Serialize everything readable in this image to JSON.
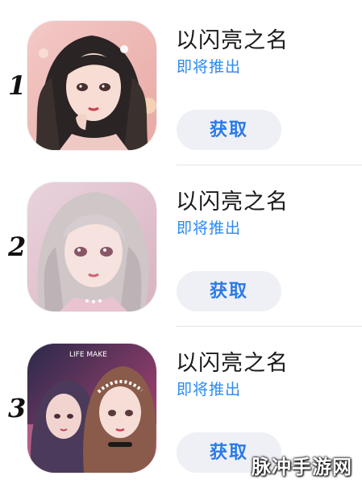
{
  "apps": [
    {
      "rank": "1",
      "title": "以闪亮之名",
      "subtitle": "即将推出",
      "button_label": "获取"
    },
    {
      "rank": "2",
      "title": "以闪亮之名",
      "subtitle": "即将推出",
      "button_label": "获取"
    },
    {
      "rank": "3",
      "title": "以闪亮之名",
      "subtitle": "即将推出",
      "button_label": "获取",
      "icon_caption": "LIFE MAKE"
    }
  ],
  "watermark": "脉冲手游网",
  "colors": {
    "accent": "#2a8bf2",
    "button_bg": "#eef0f5",
    "button_text": "#2a7ae8",
    "title": "#1a1a1a"
  },
  "icons": [
    "app-icon-character-portrait-1",
    "app-icon-character-portrait-2",
    "app-icon-character-duo-3"
  ]
}
